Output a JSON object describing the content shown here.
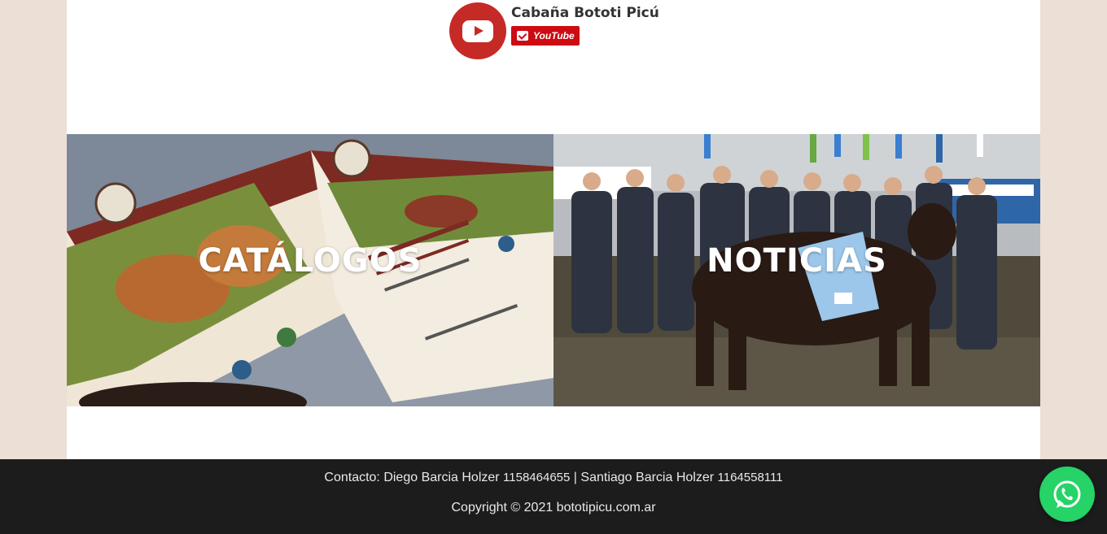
{
  "channel": {
    "name": "Cabaña Bototi Picú",
    "subscribe_label": "YouTube",
    "icon": "youtube-play-icon",
    "accent": "#c62a27"
  },
  "tiles": [
    {
      "label": "CATÁLOGOS",
      "image": "open-auction-catalog-photo"
    },
    {
      "label": "NOTICIAS",
      "image": "cattle-show-winners-photo"
    }
  ],
  "footer": {
    "contact_prefix": "Contacto: Diego Barcia Holzer ",
    "phone1": "1158464655",
    "separator": " | Santiago Barcia Holzer ",
    "phone2": "1164558111",
    "copyright": "Copyright © 2021 bototipicu.com.ar"
  },
  "whatsapp": {
    "icon": "whatsapp-icon",
    "color": "#25d366"
  }
}
